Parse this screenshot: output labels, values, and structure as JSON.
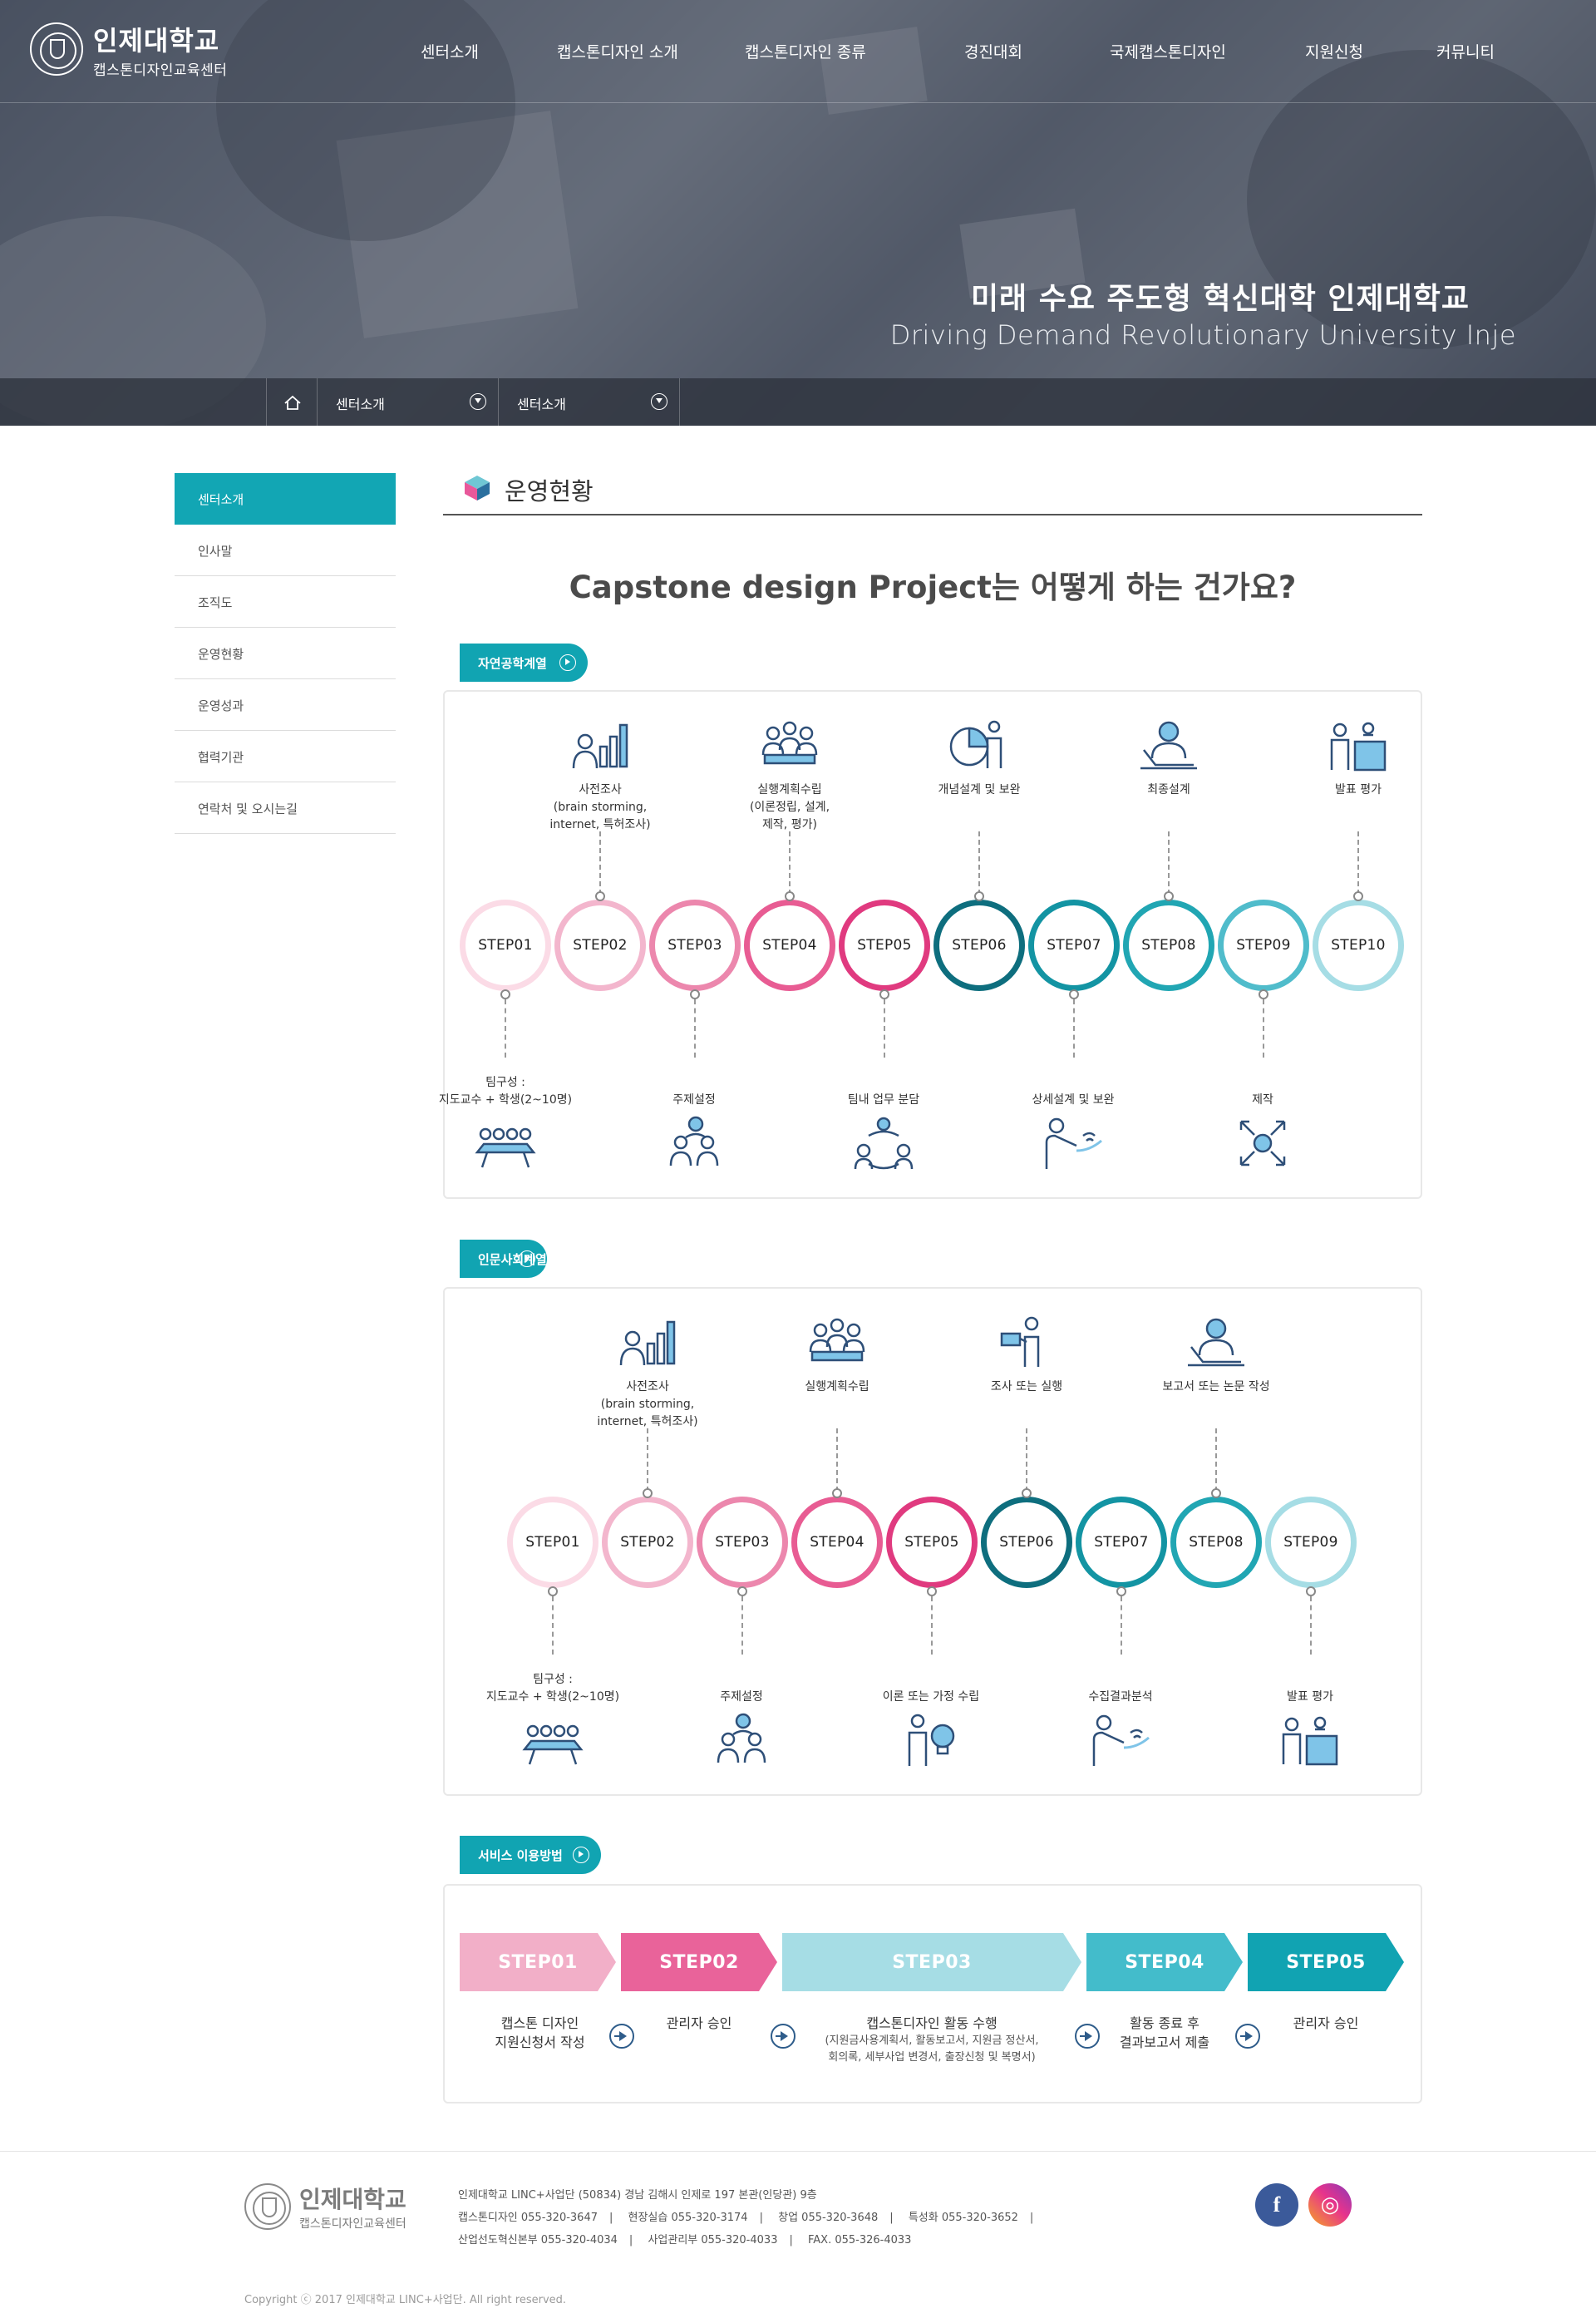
{
  "header": {
    "logo_title": "인제대학교",
    "logo_subtitle": "캡스톤디자인교육센터",
    "nav": [
      "센터소개",
      "캡스톤디자인 소개",
      "캡스톤디자인 종류",
      "경진대회",
      "국제캡스톤디자인",
      "지원신청",
      "커뮤니티"
    ],
    "slogan_ko": "미래 수요 주도형 혁신대학 인제대학교",
    "slogan_en": "Driving Demand Revolutionary University Inje"
  },
  "breadcrumb": {
    "level1": "센터소개",
    "level2": "센터소개"
  },
  "lnb": {
    "active": "센터소개",
    "items": [
      "인사말",
      "조직도",
      "운영현황",
      "운영성과",
      "협력기관",
      "연락처 및 오시는길"
    ]
  },
  "page": {
    "title": "운영현황",
    "question": "Capstone design Project는 어떻게 하는 건가요?"
  },
  "science": {
    "tag": "자연공학계열",
    "steps": [
      "STEP01",
      "STEP02",
      "STEP03",
      "STEP04",
      "STEP05",
      "STEP06",
      "STEP07",
      "STEP08",
      "STEP09",
      "STEP10"
    ],
    "top_labels": [
      {
        "l1": "사전조사",
        "l2": "(brain storming,",
        "l3": "internet, 특허조사)"
      },
      {
        "l1": "실행계획수립",
        "l2": "(이론정립, 설계,",
        "l3": "제작, 평가)"
      },
      {
        "l1": "개념설계 및 보완",
        "l2": "",
        "l3": ""
      },
      {
        "l1": "최종설계",
        "l2": "",
        "l3": ""
      },
      {
        "l1": "발표 평가",
        "l2": "",
        "l3": ""
      }
    ],
    "bottom_labels": [
      {
        "l1": "팀구성 :",
        "l2": "지도교수 + 학생(2~10명)"
      },
      {
        "l1": "주제설정",
        "l2": ""
      },
      {
        "l1": "팀내 업무 분담",
        "l2": ""
      },
      {
        "l1": "상세설계 및 보완",
        "l2": ""
      },
      {
        "l1": "제작",
        "l2": ""
      }
    ]
  },
  "humanities": {
    "tag": "인문사회계열",
    "steps": [
      "STEP01",
      "STEP02",
      "STEP03",
      "STEP04",
      "STEP05",
      "STEP06",
      "STEP07",
      "STEP08",
      "STEP09"
    ],
    "top_labels": [
      {
        "l1": "사전조사",
        "l2": "(brain storming,",
        "l3": "internet, 특허조사)"
      },
      {
        "l1": "실행계획수립",
        "l2": "",
        "l3": ""
      },
      {
        "l1": "조사 또는 실행",
        "l2": "",
        "l3": ""
      },
      {
        "l1": "보고서 또는 논문 작성",
        "l2": "",
        "l3": ""
      }
    ],
    "bottom_labels": [
      {
        "l1": "팀구성 :",
        "l2": "지도교수 + 학생(2~10명)"
      },
      {
        "l1": "주제설정",
        "l2": ""
      },
      {
        "l1": "이론 또는 가정 수립",
        "l2": ""
      },
      {
        "l1": "수집결과분석",
        "l2": ""
      },
      {
        "l1": "발표 평가",
        "l2": ""
      }
    ]
  },
  "service": {
    "tag": "서비스 이용방법",
    "steps": [
      {
        "label": "STEP01",
        "l1": "캡스톤 디자인",
        "l2": "지원신청서 작성",
        "l3": ""
      },
      {
        "label": "STEP02",
        "l1": "관리자 승인",
        "l2": "",
        "l3": ""
      },
      {
        "label": "STEP03",
        "l1": "캡스톤디자인 활동 수행",
        "l2": "(지원금사용계획서, 활동보고서, 지원금 정산서,",
        "l3": "회의록, 세부사업 변경서, 출장신청 및 복명서)"
      },
      {
        "label": "STEP04",
        "l1": "활동 종료 후",
        "l2": "결과보고서 제출",
        "l3": ""
      },
      {
        "label": "STEP05",
        "l1": "관리자 승인",
        "l2": "",
        "l3": ""
      }
    ]
  },
  "footer": {
    "logo_title": "인제대학교",
    "logo_subtitle": "캡스톤디자인교육센터",
    "address": "인제대학교 LINC+사업단 (50834) 경남 김해시 인제로 197 본관(인당관) 9층",
    "phones1": [
      "캡스톤디자인 055-320-3647",
      "현장실습 055-320-3174",
      "창업 055-320-3648",
      "특성화 055-320-3652"
    ],
    "phones2": [
      "산업선도혁신본부 055-320-4034",
      "사업관리부 055-320-4033",
      "FAX. 055-326-4033"
    ],
    "copyright": "Copyright ⓒ 2017 인제대학교 LINC+사업단. All right reserved.",
    "facebook": "f",
    "instagram": "◎"
  },
  "colors": {
    "accent": "#12a6b4",
    "step_pink": [
      "#fbdbe6",
      "#f3b6cd",
      "#ec87ad",
      "#e85c93",
      "#e03a7f"
    ],
    "step_teal": [
      "#0e6e7e",
      "#1394a3",
      "#21a6b3",
      "#50bccb",
      "#a6dde5"
    ]
  }
}
